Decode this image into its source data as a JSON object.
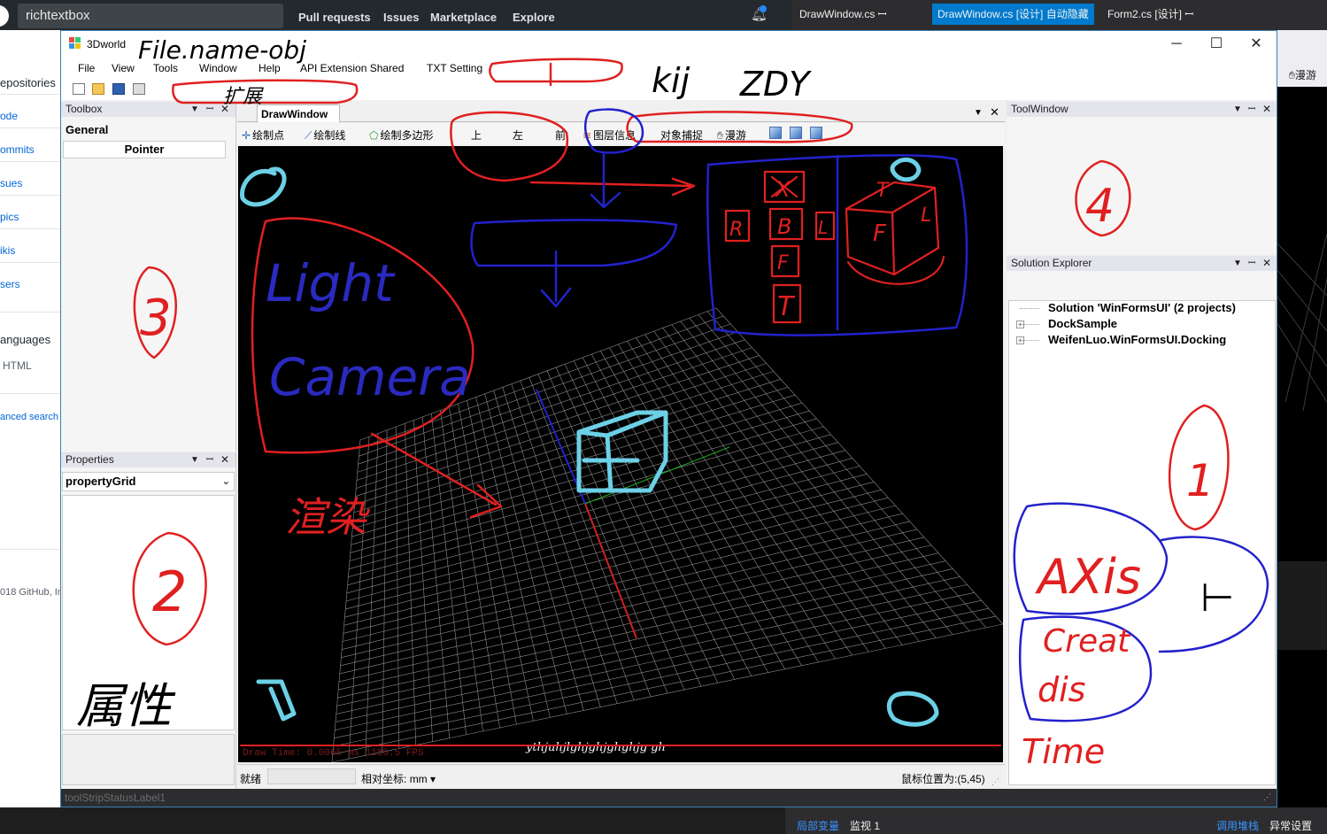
{
  "github": {
    "repo_name": "richtextbox",
    "nav": [
      "Pull requests",
      "Issues",
      "Marketplace",
      "Explore"
    ],
    "sidebar": [
      "epositories",
      "ode",
      "ommits",
      "sues",
      "pics",
      "ikis",
      "sers"
    ],
    "languages_label": "anguages",
    "language": "HTML",
    "advanced_search": "anced search",
    "footer": "018 GitHub, In"
  },
  "vs": {
    "tabs": [
      "DrawWindow.cs",
      "DrawWindow.cs [设计] 自动隐藏",
      "Form2.cs [设计]"
    ],
    "roam_label": "漫游",
    "bottom_left": [
      "局部变量",
      "监视 1"
    ],
    "bottom_right": [
      "调用堆栈",
      "异常设置"
    ]
  },
  "app": {
    "title": "3Dworld",
    "menu": [
      "File",
      "View",
      "Tools",
      "Window",
      "Help",
      "API Extension Shared",
      "TXT Setting"
    ],
    "toolbox": {
      "title": "Toolbox",
      "group": "General",
      "item": "Pointer"
    },
    "properties": {
      "title": "Properties",
      "selected": "propertyGrid"
    },
    "document": {
      "tab": "DrawWindow",
      "tools": [
        "绘制点",
        "绘制线",
        "绘制多边形",
        "上",
        "左",
        "前",
        "图层信息",
        "对象捕捉",
        "漫游"
      ],
      "draw_time": "Draw Time: 0.0065 ms    1180.5 FPS",
      "scribble": "ythjuhjlghjghjghghjg  gh"
    },
    "statusbar": {
      "ready": "就绪",
      "coord_label": "相对坐标:",
      "unit": "mm",
      "mouse_pos": "鼠标位置为:(5,45)"
    },
    "toolwindow": {
      "title": "ToolWindow"
    },
    "solution_explorer": {
      "title": "Solution Explorer",
      "items": [
        "Solution 'WinFormsUI' (2 projects)",
        "DockSample",
        "WeifenLuo.WinFormsUI.Docking"
      ]
    },
    "bottom_status": "toolStripStatusLabel1"
  },
  "annotations": {
    "filename": "File.name-obj",
    "kij": "kij",
    "zdy": "ZDY",
    "extend": "扩展",
    "light": "Light",
    "camera": "Camera",
    "render": "渲染",
    "attribute": "属性",
    "axis": "AXis",
    "creat": "Creat",
    "dis": "dis",
    "time": "Time",
    "numbers": [
      "1",
      "2",
      "3",
      "4"
    ],
    "cube_faces": [
      "X",
      "R",
      "B",
      "L",
      "F",
      "T",
      "T",
      "F",
      "L"
    ]
  }
}
